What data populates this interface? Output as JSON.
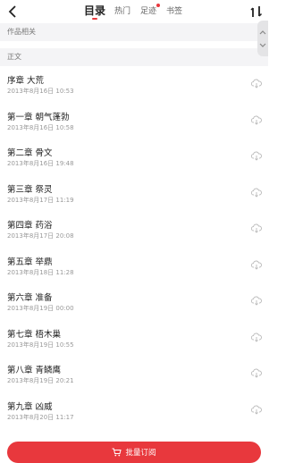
{
  "header": {
    "back_icon": "chevron-left-icon",
    "tabs": [
      {
        "label": "目录",
        "active": true
      },
      {
        "label": "热门",
        "active": false
      },
      {
        "label": "足迹",
        "active": false,
        "badge": true
      },
      {
        "label": "书签",
        "active": false
      }
    ],
    "sort_icon": "sort-order-icon",
    "accent_color": "#e8383d"
  },
  "sections": {
    "related": "作品相关",
    "main": "正文"
  },
  "chapters": [
    {
      "title": "序章 大荒",
      "date": "2013年8月16日 10:53"
    },
    {
      "title": "第一章 朝气蓬勃",
      "date": "2013年8月16日 10:58"
    },
    {
      "title": "第二章 骨文",
      "date": "2013年8月16日 19:48"
    },
    {
      "title": "第三章 祭灵",
      "date": "2013年8月17日 11:19"
    },
    {
      "title": "第四章 药浴",
      "date": "2013年8月17日 20:08"
    },
    {
      "title": "第五章 举鼎",
      "date": "2013年8月18日 11:28"
    },
    {
      "title": "第六章 准备",
      "date": "2013年8月19日 00:00"
    },
    {
      "title": "第七章 梧木巢",
      "date": "2013年8月19日 10:55"
    },
    {
      "title": "第八章 青鳞鹰",
      "date": "2013年8月19日 20:21"
    },
    {
      "title": "第九章 凶威",
      "date": "2013年8月20日 11:17"
    }
  ],
  "chapter_icon": "cloud-download-icon",
  "footer": {
    "bulk_label": "批量订阅",
    "icon": "cart-icon"
  }
}
